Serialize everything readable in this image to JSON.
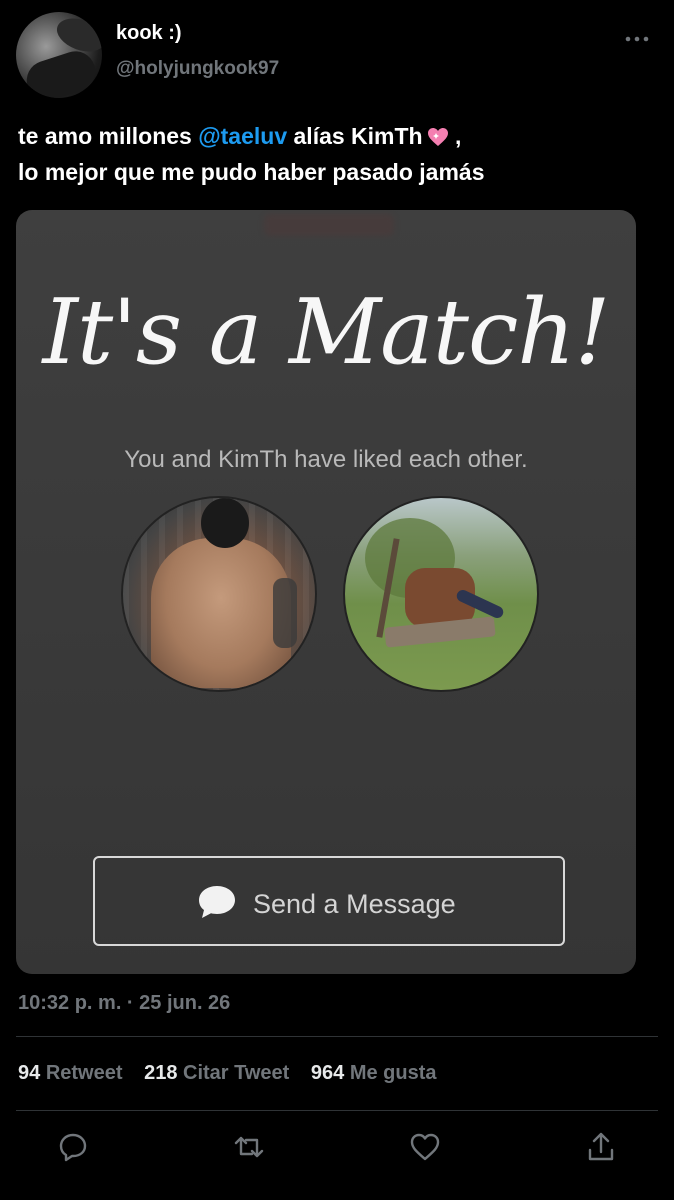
{
  "user": {
    "display_name": "kook :)",
    "handle": "@holyjungkook97"
  },
  "more_icon": "more-horizontal-icon",
  "tweet": {
    "text_part1": "te amo millones ",
    "mention": "@taeluv",
    "text_part2": " alías KimTh",
    "emoji": "sparkling-heart-icon",
    "text_part3": " ,",
    "text_line2": "lo mejor que me pudo haber pasado jamás"
  },
  "media": {
    "title": "It's a Match!",
    "subtitle": "You and KimTh have liked each other.",
    "button_label": "Send a Message",
    "button_icon": "chat-bubble-icon"
  },
  "meta": {
    "timestamp": "10:32 p. m. · 25 jun. 26"
  },
  "stats": {
    "retweets_count": "94",
    "retweets_label": "Retweet",
    "quotes_count": "218",
    "quotes_label": "Citar Tweet",
    "likes_count": "964",
    "likes_label": "Me gusta"
  },
  "actions": [
    "reply-icon",
    "retweet-icon",
    "like-icon",
    "share-icon"
  ],
  "colors": {
    "background": "#000000",
    "mention": "#1d9bf0",
    "secondary_text": "#71767b"
  }
}
